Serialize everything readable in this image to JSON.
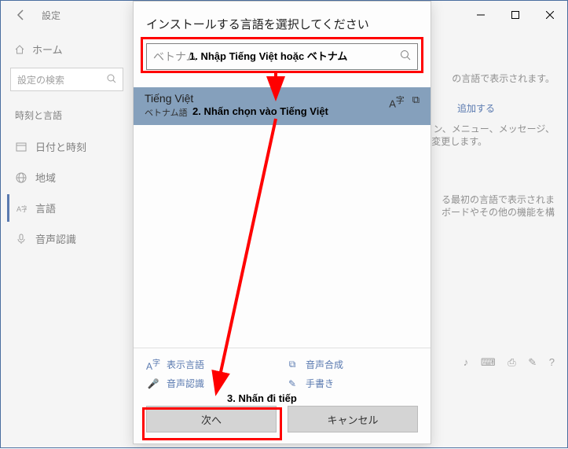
{
  "titlebar": {
    "back_icon": "←",
    "app_title": "設定"
  },
  "sidebar": {
    "home": {
      "label": "ホーム"
    },
    "search_placeholder": "設定の検索",
    "section": "時刻と言語",
    "items": [
      {
        "label": "日付と時刻",
        "icon": "date"
      },
      {
        "label": "地域",
        "icon": "globe"
      },
      {
        "label": "言語",
        "icon": "lang"
      },
      {
        "label": "音声認識",
        "icon": "mic"
      }
    ]
  },
  "dialog": {
    "title": "インストールする言語を選択してください",
    "search_placeholder": "ベトナム",
    "lang": {
      "main": "Tiếng Việt",
      "sub": "ベトナム語"
    },
    "features": {
      "display": "表示言語",
      "tts": "音声合成",
      "sr": "音声認識",
      "hw": "手書き"
    },
    "buttons": {
      "next": "次へ",
      "cancel": "キャンセル"
    }
  },
  "bg_text": {
    "t1": "の言語で表示されます。",
    "t2": "追加する",
    "t3": "ョン、メニュー、メッセージ、",
    "t4": "変更します。",
    "t5": "る最初の言語で表示されま",
    "t6": "ボードやその他の機能を構"
  },
  "annotations": {
    "a1": "1. Nhập Tiếng Việt hoặc ベトナム",
    "a2": "2. Nhấn chọn vào Tiếng Việt",
    "a3": "3. Nhấn đi tiếp"
  }
}
